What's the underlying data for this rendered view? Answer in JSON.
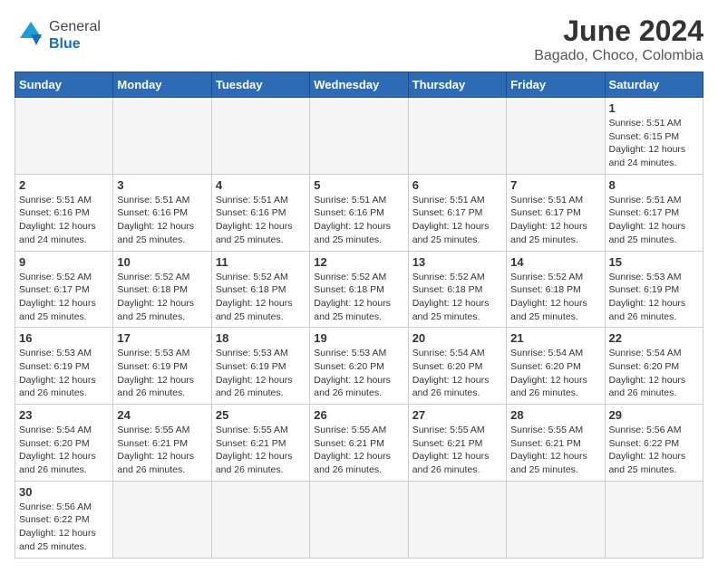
{
  "header": {
    "logo_general": "General",
    "logo_blue": "Blue",
    "month_title": "June 2024",
    "location": "Bagado, Choco, Colombia"
  },
  "days_of_week": [
    "Sunday",
    "Monday",
    "Tuesday",
    "Wednesday",
    "Thursday",
    "Friday",
    "Saturday"
  ],
  "weeks": [
    [
      {
        "day": "",
        "info": ""
      },
      {
        "day": "",
        "info": ""
      },
      {
        "day": "",
        "info": ""
      },
      {
        "day": "",
        "info": ""
      },
      {
        "day": "",
        "info": ""
      },
      {
        "day": "",
        "info": ""
      },
      {
        "day": "1",
        "info": "Sunrise: 5:51 AM\nSunset: 6:15 PM\nDaylight: 12 hours and 24 minutes."
      }
    ],
    [
      {
        "day": "2",
        "info": "Sunrise: 5:51 AM\nSunset: 6:16 PM\nDaylight: 12 hours and 24 minutes."
      },
      {
        "day": "3",
        "info": "Sunrise: 5:51 AM\nSunset: 6:16 PM\nDaylight: 12 hours and 25 minutes."
      },
      {
        "day": "4",
        "info": "Sunrise: 5:51 AM\nSunset: 6:16 PM\nDaylight: 12 hours and 25 minutes."
      },
      {
        "day": "5",
        "info": "Sunrise: 5:51 AM\nSunset: 6:16 PM\nDaylight: 12 hours and 25 minutes."
      },
      {
        "day": "6",
        "info": "Sunrise: 5:51 AM\nSunset: 6:17 PM\nDaylight: 12 hours and 25 minutes."
      },
      {
        "day": "7",
        "info": "Sunrise: 5:51 AM\nSunset: 6:17 PM\nDaylight: 12 hours and 25 minutes."
      },
      {
        "day": "8",
        "info": "Sunrise: 5:51 AM\nSunset: 6:17 PM\nDaylight: 12 hours and 25 minutes."
      }
    ],
    [
      {
        "day": "9",
        "info": "Sunrise: 5:52 AM\nSunset: 6:17 PM\nDaylight: 12 hours and 25 minutes."
      },
      {
        "day": "10",
        "info": "Sunrise: 5:52 AM\nSunset: 6:18 PM\nDaylight: 12 hours and 25 minutes."
      },
      {
        "day": "11",
        "info": "Sunrise: 5:52 AM\nSunset: 6:18 PM\nDaylight: 12 hours and 25 minutes."
      },
      {
        "day": "12",
        "info": "Sunrise: 5:52 AM\nSunset: 6:18 PM\nDaylight: 12 hours and 25 minutes."
      },
      {
        "day": "13",
        "info": "Sunrise: 5:52 AM\nSunset: 6:18 PM\nDaylight: 12 hours and 25 minutes."
      },
      {
        "day": "14",
        "info": "Sunrise: 5:52 AM\nSunset: 6:18 PM\nDaylight: 12 hours and 25 minutes."
      },
      {
        "day": "15",
        "info": "Sunrise: 5:53 AM\nSunset: 6:19 PM\nDaylight: 12 hours and 26 minutes."
      }
    ],
    [
      {
        "day": "16",
        "info": "Sunrise: 5:53 AM\nSunset: 6:19 PM\nDaylight: 12 hours and 26 minutes."
      },
      {
        "day": "17",
        "info": "Sunrise: 5:53 AM\nSunset: 6:19 PM\nDaylight: 12 hours and 26 minutes."
      },
      {
        "day": "18",
        "info": "Sunrise: 5:53 AM\nSunset: 6:19 PM\nDaylight: 12 hours and 26 minutes."
      },
      {
        "day": "19",
        "info": "Sunrise: 5:53 AM\nSunset: 6:20 PM\nDaylight: 12 hours and 26 minutes."
      },
      {
        "day": "20",
        "info": "Sunrise: 5:54 AM\nSunset: 6:20 PM\nDaylight: 12 hours and 26 minutes."
      },
      {
        "day": "21",
        "info": "Sunrise: 5:54 AM\nSunset: 6:20 PM\nDaylight: 12 hours and 26 minutes."
      },
      {
        "day": "22",
        "info": "Sunrise: 5:54 AM\nSunset: 6:20 PM\nDaylight: 12 hours and 26 minutes."
      }
    ],
    [
      {
        "day": "23",
        "info": "Sunrise: 5:54 AM\nSunset: 6:20 PM\nDaylight: 12 hours and 26 minutes."
      },
      {
        "day": "24",
        "info": "Sunrise: 5:55 AM\nSunset: 6:21 PM\nDaylight: 12 hours and 26 minutes."
      },
      {
        "day": "25",
        "info": "Sunrise: 5:55 AM\nSunset: 6:21 PM\nDaylight: 12 hours and 26 minutes."
      },
      {
        "day": "26",
        "info": "Sunrise: 5:55 AM\nSunset: 6:21 PM\nDaylight: 12 hours and 26 minutes."
      },
      {
        "day": "27",
        "info": "Sunrise: 5:55 AM\nSunset: 6:21 PM\nDaylight: 12 hours and 26 minutes."
      },
      {
        "day": "28",
        "info": "Sunrise: 5:55 AM\nSunset: 6:21 PM\nDaylight: 12 hours and 25 minutes."
      },
      {
        "day": "29",
        "info": "Sunrise: 5:56 AM\nSunset: 6:22 PM\nDaylight: 12 hours and 25 minutes."
      }
    ],
    [
      {
        "day": "30",
        "info": "Sunrise: 5:56 AM\nSunset: 6:22 PM\nDaylight: 12 hours and 25 minutes."
      },
      {
        "day": "",
        "info": ""
      },
      {
        "day": "",
        "info": ""
      },
      {
        "day": "",
        "info": ""
      },
      {
        "day": "",
        "info": ""
      },
      {
        "day": "",
        "info": ""
      },
      {
        "day": "",
        "info": ""
      }
    ]
  ]
}
